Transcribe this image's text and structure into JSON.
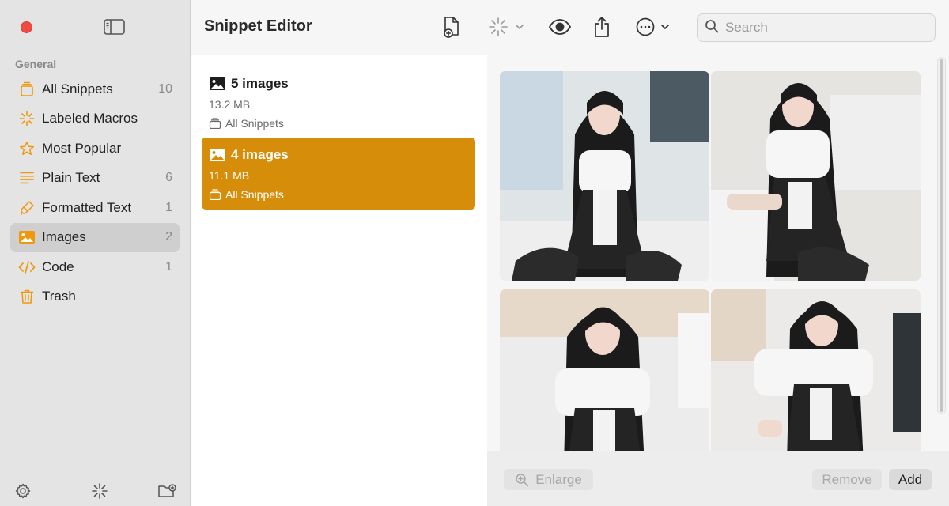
{
  "window": {
    "title": "Snippet Editor"
  },
  "sidebar": {
    "section_label": "General",
    "items": [
      {
        "label": "All Snippets",
        "count": "10",
        "icon": "stack-icon"
      },
      {
        "label": "Labeled Macros",
        "count": "",
        "icon": "sparkle-icon"
      },
      {
        "label": "Most Popular",
        "count": "",
        "icon": "star-icon"
      },
      {
        "label": "Plain Text",
        "count": "6",
        "icon": "lines-icon"
      },
      {
        "label": "Formatted Text",
        "count": "1",
        "icon": "brush-icon"
      },
      {
        "label": "Images",
        "count": "2",
        "icon": "photo-icon",
        "selected": true
      },
      {
        "label": "Code",
        "count": "1",
        "icon": "code-icon"
      },
      {
        "label": "Trash",
        "count": "",
        "icon": "trash-icon"
      }
    ]
  },
  "toolbar": {
    "search_placeholder": "Search"
  },
  "snippets": [
    {
      "title": "5 images",
      "size": "13.2 MB",
      "folder": "All Snippets",
      "selected": false
    },
    {
      "title": "4 images",
      "size": "11.1 MB",
      "folder": "All Snippets",
      "selected": true
    }
  ],
  "preview": {
    "enlarge_label": "Enlarge",
    "remove_label": "Remove",
    "add_label": "Add"
  },
  "colors": {
    "accent": "#d68d0a",
    "icon_orange": "#f0980c",
    "close": "#ee4b45"
  }
}
